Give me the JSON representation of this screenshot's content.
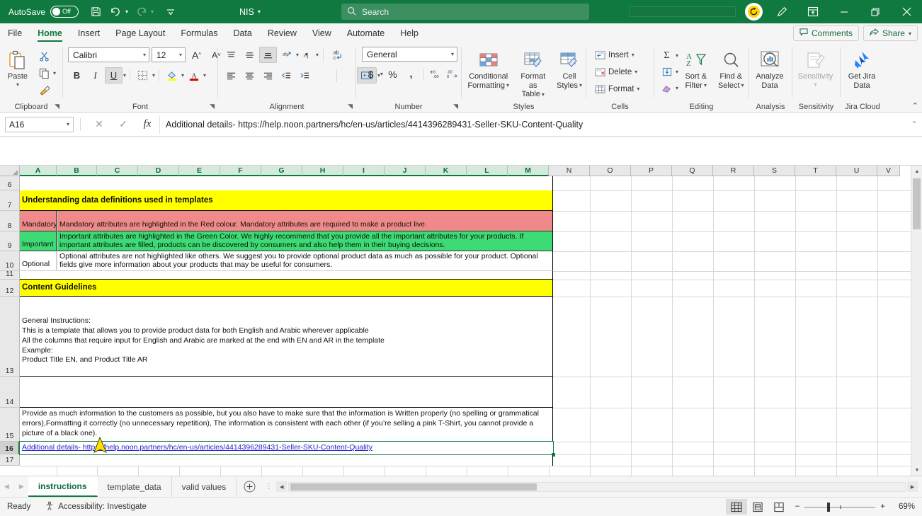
{
  "titlebar": {
    "autosave_label": "AutoSave",
    "autosave_state": "Off",
    "save_icon": "save-icon",
    "undo_icon": "undo-icon",
    "redo_icon": "redo-icon",
    "customize_icon": "customize-quick-access-icon",
    "account_label": "NIS",
    "search_placeholder": "Search",
    "search_icon": "search-icon",
    "copilot_icon": "copilot-icon",
    "ribbon_display_icon": "ribbon-display-options-icon",
    "minimize_icon": "minimize-icon",
    "restore_icon": "restore-icon",
    "close_icon": "close-icon"
  },
  "ribbon_tabs": {
    "items": [
      {
        "label": "File",
        "active": false
      },
      {
        "label": "Home",
        "active": true
      },
      {
        "label": "Insert",
        "active": false
      },
      {
        "label": "Page Layout",
        "active": false
      },
      {
        "label": "Formulas",
        "active": false
      },
      {
        "label": "Data",
        "active": false
      },
      {
        "label": "Review",
        "active": false
      },
      {
        "label": "View",
        "active": false
      },
      {
        "label": "Automate",
        "active": false
      },
      {
        "label": "Help",
        "active": false
      }
    ],
    "comments_label": "Comments",
    "share_label": "Share"
  },
  "ribbon": {
    "clipboard": {
      "group_label": "Clipboard",
      "paste_label": "Paste",
      "cut_label": "Cut",
      "copy_label": "Copy",
      "format_painter_label": "Format Painter"
    },
    "font": {
      "group_label": "Font",
      "font_name": "Calibri",
      "font_size": "12",
      "grow_font": "A",
      "shrink_font": "A",
      "bold": "B",
      "italic": "I",
      "underline": "U",
      "borders_label": "Borders",
      "fill_color_label": "Fill Color",
      "font_color_label": "Font Color"
    },
    "alignment": {
      "group_label": "Alignment",
      "top_align": "Top Align",
      "middle_align": "Middle Align",
      "bottom_align": "Bottom Align",
      "orientation": "Orientation",
      "decrease_indent": "Decrease Indent",
      "increase_indent": "Increase Indent",
      "align_left": "Align Left",
      "center": "Center",
      "align_right": "Align Right",
      "wrap_text_label": "Wrap Text",
      "merge_label": "Merge & Center"
    },
    "number": {
      "group_label": "Number",
      "format": "General",
      "accounting": "$",
      "percent": "%",
      "comma": ",",
      "increase_decimal": "Increase Decimal",
      "decrease_decimal": "Decrease Decimal"
    },
    "styles": {
      "group_label": "Styles",
      "conditional_formatting": "Conditional\nFormatting",
      "conditional_formatting_l1": "Conditional",
      "conditional_formatting_l2": "Formatting",
      "format_as_table_l1": "Format as",
      "format_as_table_l2": "Table",
      "cell_styles_l1": "Cell",
      "cell_styles_l2": "Styles"
    },
    "cells": {
      "group_label": "Cells",
      "insert_label": "Insert",
      "delete_label": "Delete",
      "format_label": "Format"
    },
    "editing": {
      "group_label": "Editing",
      "autosum": "AutoSum",
      "fill": "Fill",
      "clear": "Clear",
      "sort_filter_l1": "Sort &",
      "sort_filter_l2": "Filter",
      "find_select_l1": "Find &",
      "find_select_l2": "Select"
    },
    "analysis": {
      "group_label": "Analysis",
      "analyze_data_l1": "Analyze",
      "analyze_data_l2": "Data"
    },
    "sensitivity": {
      "group_label": "Sensitivity",
      "label": "Sensitivity"
    },
    "jira": {
      "group_label": "Jira Cloud",
      "get_jira_l1": "Get Jira",
      "get_jira_l2": "Data"
    },
    "collapse_icon": "collapse-ribbon-icon"
  },
  "formula_bar": {
    "name_box": "A16",
    "cancel_icon": "cancel-icon",
    "enter_icon": "enter-icon",
    "function_icon": "insert-function-icon",
    "value": "Additional details- https://help.noon.partners/hc/en-us/articles/4414396289431-Seller-SKU-Content-Quality",
    "expand_icon": "expand-formula-bar-icon"
  },
  "grid": {
    "columns": [
      "A",
      "B",
      "C",
      "D",
      "E",
      "F",
      "G",
      "H",
      "I",
      "J",
      "K",
      "L",
      "M",
      "N",
      "O",
      "P",
      "Q",
      "R",
      "S",
      "T",
      "U",
      "V"
    ],
    "rows": [
      "6",
      "7",
      "8",
      "9",
      "10",
      "11",
      "12",
      "13",
      "14",
      "15",
      "16",
      "17"
    ],
    "selected_cell": "A16",
    "cells": {
      "r7_title": "Understanding data definitions used in templates",
      "r8_label": "Mandatory",
      "r8_text": "Mandatory attributes are highlighted in the Red colour. Mandatory attributes are required to make a product live.",
      "r9_label": "Important",
      "r9_text": "Important attributes are highlighted in the Green Color. We highly recommend that you provide all the important attributes for your products. If important attributes are filled, products can be discovered by consumers and also help them in their buying decisions.",
      "r10_label": "Optional",
      "r10_text": "Optional attributes are not highlighted like others. We suggest you to provide optional product data as much as possible for your product. Optional fields give more information about your products that may be useful for consumers.",
      "r12_title": "Content Guidelines",
      "r13_line1": "General Instructions:",
      "r13_line2": "This is a template that allows you to provide product data for both English and Arabic wherever applicable",
      "r13_line3": "All the columns that require input for English and Arabic are marked at the end with EN and AR in the template",
      "r13_line4": "Example:",
      "r13_line5": "Product Title EN, and Product Title AR",
      "r15_text": "Provide as much information to the customers as possible, but you also have to make sure that the information is Written properly (no spelling or grammatical errors),Formatting it correctly (no unnecessary repetition), The information is consistent with each other (if you’re selling a pink T-Shirt, you cannot provide a picture of a black one).",
      "r16_link": "Additional details- https://help.noon.partners/hc/en-us/articles/4414396289431-Seller-SKU-Content-Quality"
    },
    "colors": {
      "yellow": "#ffff00",
      "red": "#f08a8a",
      "green": "#3ddb74",
      "link": "#2222cc",
      "selection": "#107c41"
    }
  },
  "sheet_tabs": {
    "prev_icon": "previous-sheet-icon",
    "next_icon": "next-sheet-icon",
    "items": [
      {
        "label": "instructions",
        "active": true
      },
      {
        "label": "template_data",
        "active": false
      },
      {
        "label": "valid values",
        "active": false
      }
    ],
    "add_label": "+"
  },
  "status_bar": {
    "mode": "Ready",
    "accessibility": "Accessibility: Investigate",
    "accessibility_icon": "accessibility-icon",
    "normal_view_icon": "normal-view-icon",
    "page_layout_icon": "page-layout-view-icon",
    "page_break_icon": "page-break-preview-icon",
    "zoom_out": "−",
    "zoom_in": "+",
    "zoom_level": "69%"
  }
}
